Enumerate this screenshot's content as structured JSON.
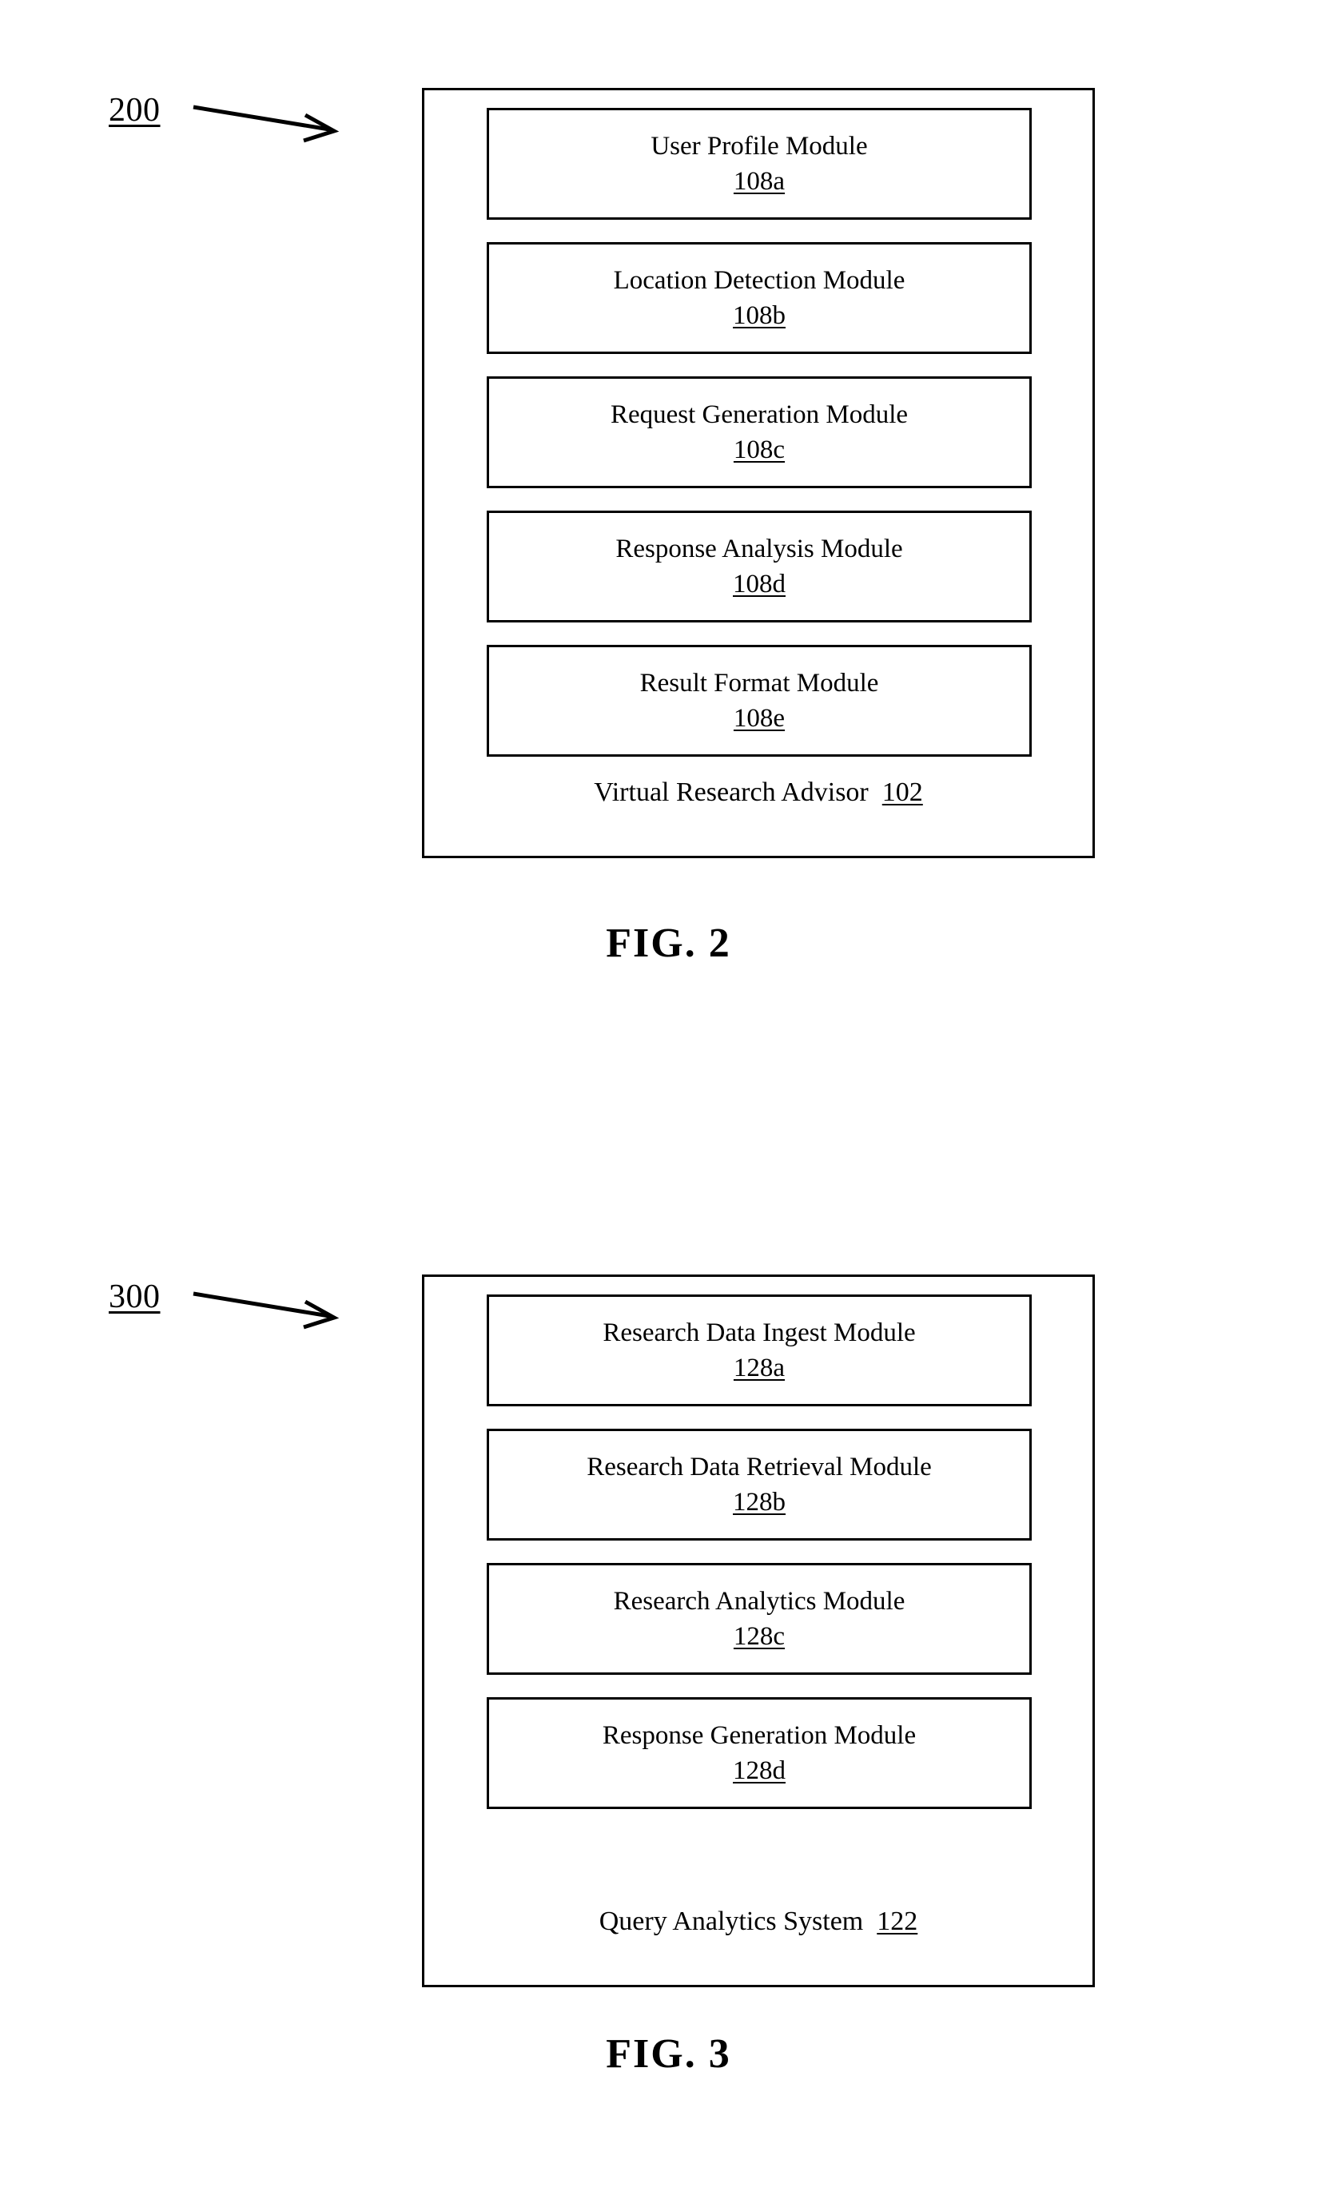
{
  "document": {
    "type": "patent-drawing-sheet",
    "figures": [
      {
        "id": "figure-2",
        "callout_number": "200",
        "caption": "FIG. 2",
        "container": {
          "label_text": "Virtual Research Advisor",
          "label_ref": "102"
        },
        "modules": [
          {
            "title": "User Profile Module",
            "ref": "108a"
          },
          {
            "title": "Location Detection Module",
            "ref": "108b"
          },
          {
            "title": "Request Generation Module",
            "ref": "108c"
          },
          {
            "title": "Response Analysis Module",
            "ref": "108d"
          },
          {
            "title": "Result Format Module",
            "ref": "108e"
          }
        ]
      },
      {
        "id": "figure-3",
        "callout_number": "300",
        "caption": "FIG. 3",
        "container": {
          "label_text": "Query Analytics System",
          "label_ref": "122"
        },
        "modules": [
          {
            "title": "Research Data Ingest Module",
            "ref": "128a"
          },
          {
            "title": "Research Data Retrieval Module",
            "ref": "128b"
          },
          {
            "title": "Research Analytics Module",
            "ref": "128c"
          },
          {
            "title": "Response Generation Module",
            "ref": "128d"
          }
        ]
      }
    ],
    "colors": {
      "ink": "#000000",
      "paper": "#ffffff"
    }
  }
}
